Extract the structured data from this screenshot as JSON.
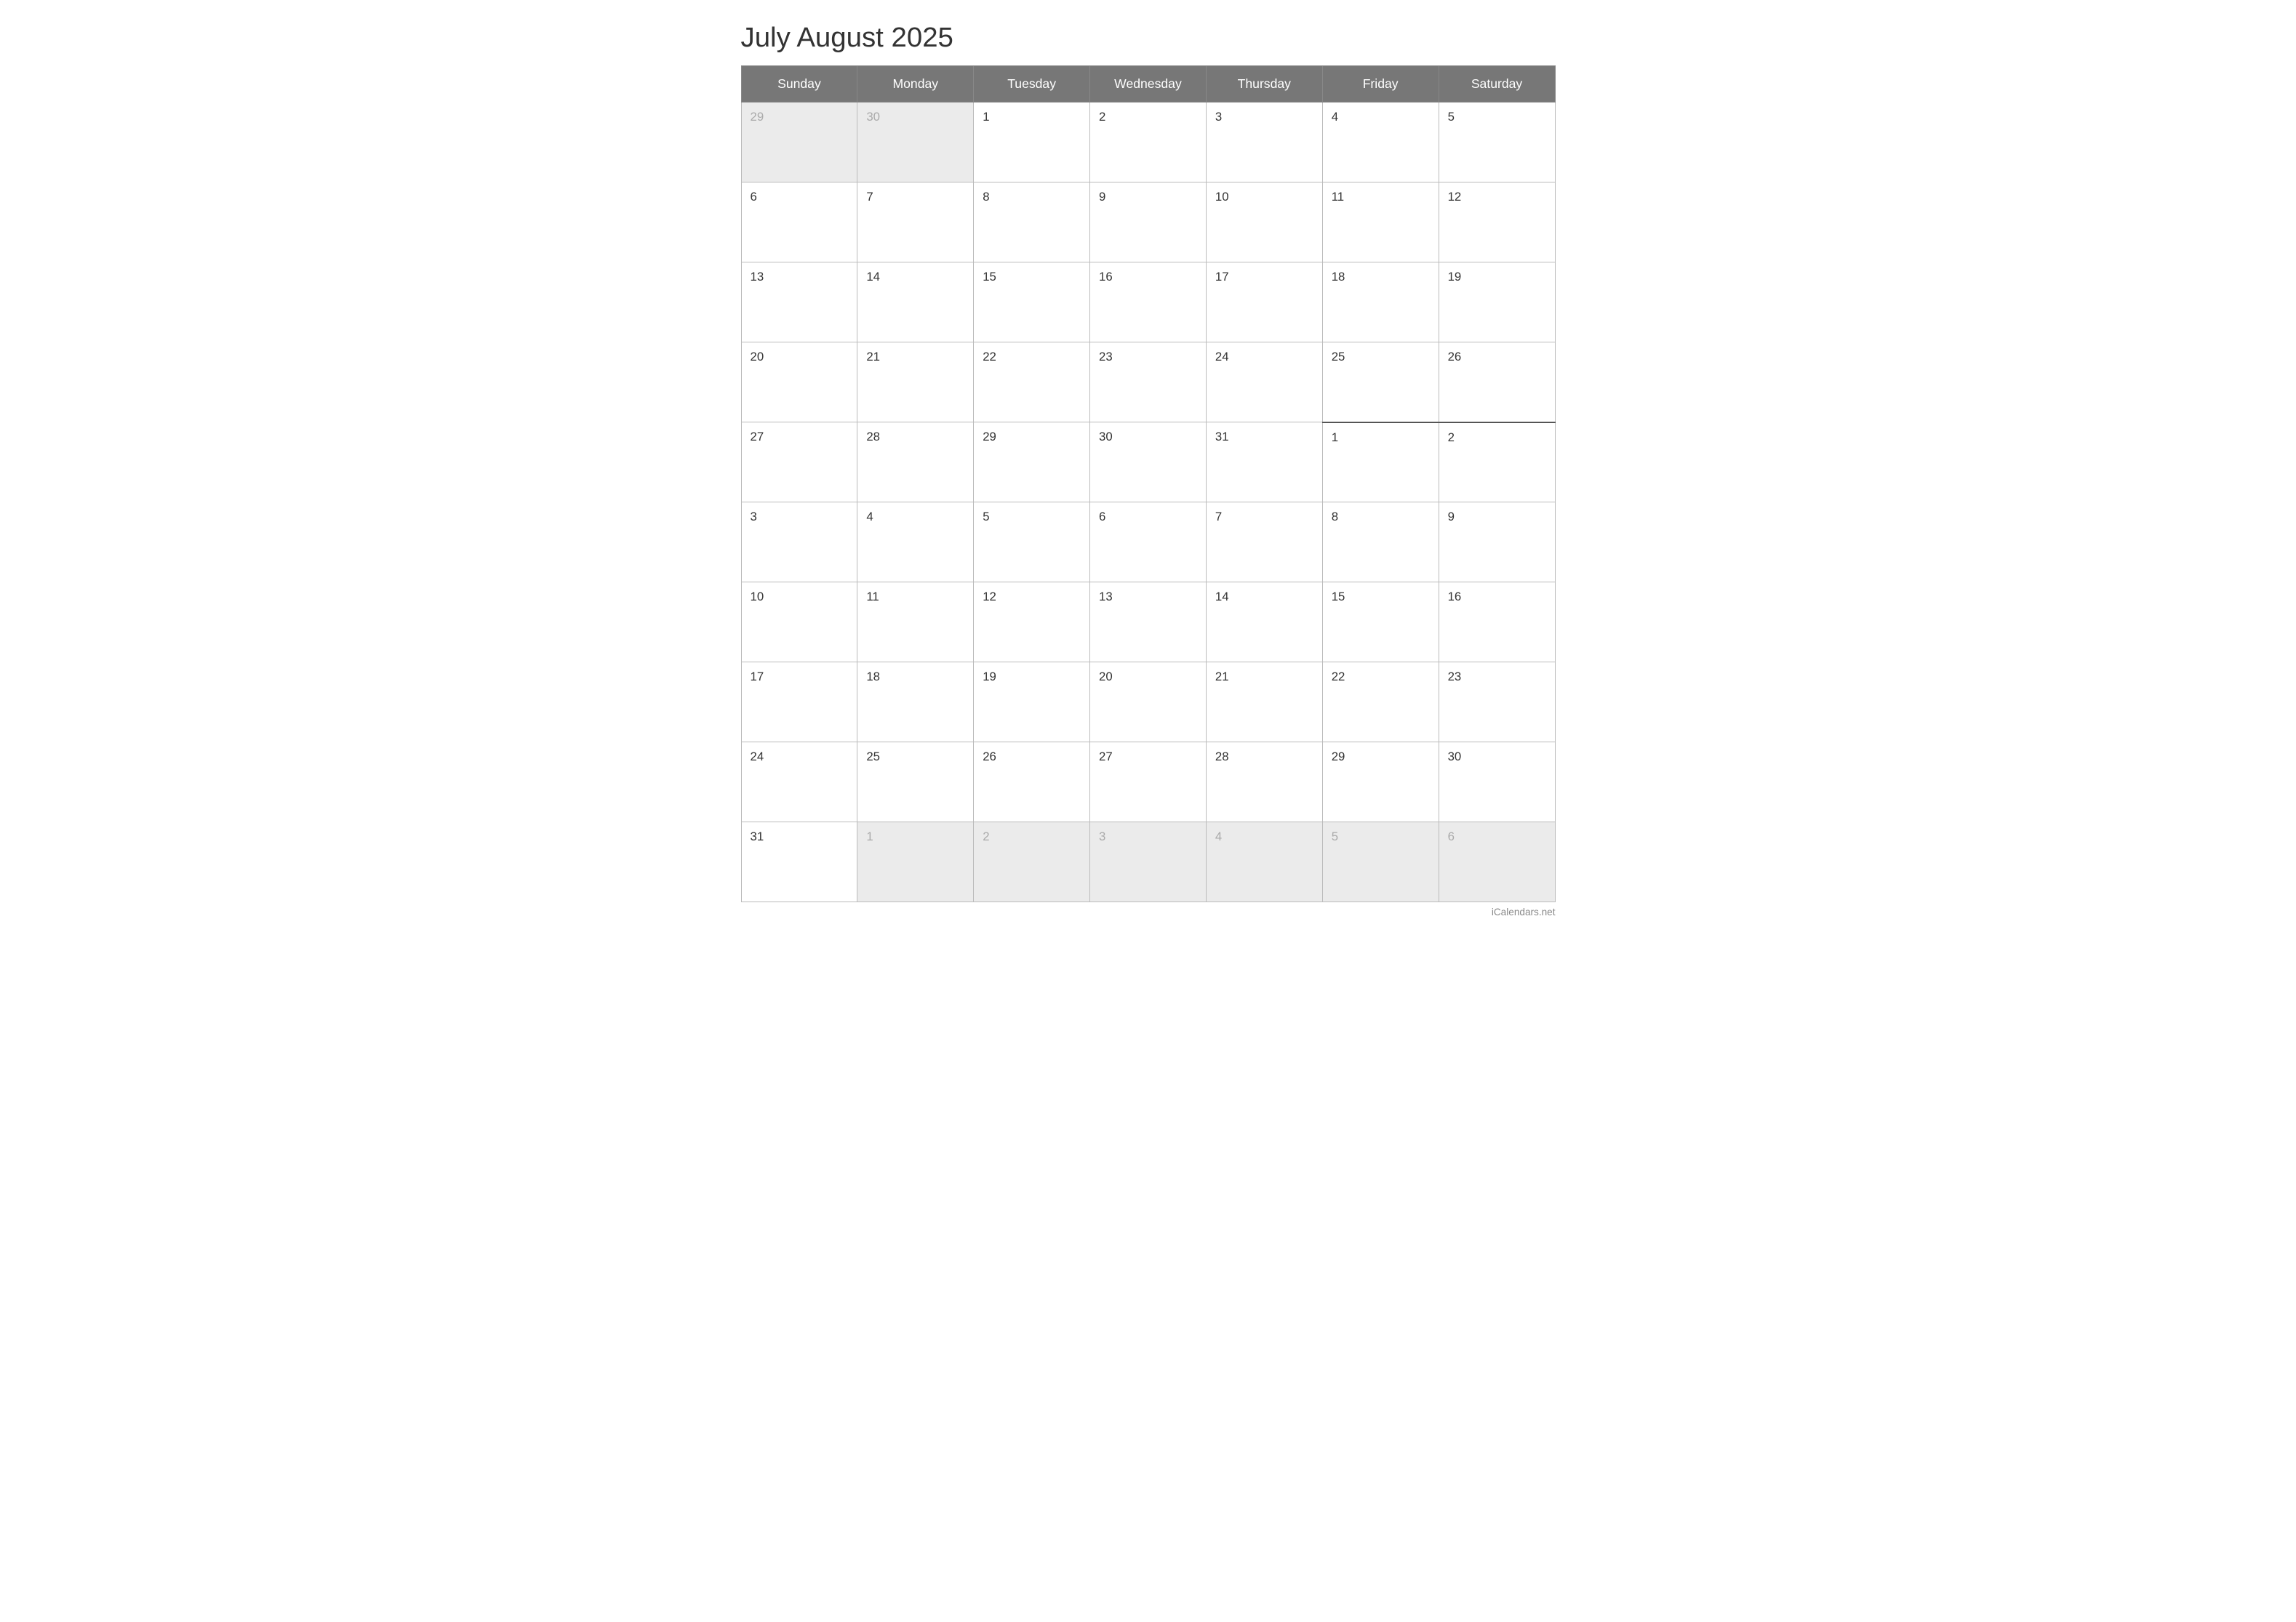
{
  "title": "July August 2025",
  "days_of_week": [
    "Sunday",
    "Monday",
    "Tuesday",
    "Wednesday",
    "Thursday",
    "Friday",
    "Saturday"
  ],
  "weeks": [
    {
      "cells": [
        {
          "day": "29",
          "out": true
        },
        {
          "day": "30",
          "out": true
        },
        {
          "day": "1",
          "out": false
        },
        {
          "day": "2",
          "out": false
        },
        {
          "day": "3",
          "out": false
        },
        {
          "day": "4",
          "out": false
        },
        {
          "day": "5",
          "out": false
        }
      ],
      "divider": false
    },
    {
      "cells": [
        {
          "day": "6",
          "out": false
        },
        {
          "day": "7",
          "out": false
        },
        {
          "day": "8",
          "out": false
        },
        {
          "day": "9",
          "out": false
        },
        {
          "day": "10",
          "out": false
        },
        {
          "day": "11",
          "out": false
        },
        {
          "day": "12",
          "out": false
        }
      ],
      "divider": false
    },
    {
      "cells": [
        {
          "day": "13",
          "out": false
        },
        {
          "day": "14",
          "out": false
        },
        {
          "day": "15",
          "out": false
        },
        {
          "day": "16",
          "out": false
        },
        {
          "day": "17",
          "out": false
        },
        {
          "day": "18",
          "out": false
        },
        {
          "day": "19",
          "out": false
        }
      ],
      "divider": false
    },
    {
      "cells": [
        {
          "day": "20",
          "out": false
        },
        {
          "day": "21",
          "out": false
        },
        {
          "day": "22",
          "out": false
        },
        {
          "day": "23",
          "out": false
        },
        {
          "day": "24",
          "out": false
        },
        {
          "day": "25",
          "out": false
        },
        {
          "day": "26",
          "out": false
        }
      ],
      "divider": false
    },
    {
      "cells": [
        {
          "day": "27",
          "out": false
        },
        {
          "day": "28",
          "out": false
        },
        {
          "day": "29",
          "out": false
        },
        {
          "day": "30",
          "out": false
        },
        {
          "day": "31",
          "out": false
        },
        {
          "day": "1",
          "out": false,
          "new_month": true
        },
        {
          "day": "2",
          "out": false,
          "new_month": true
        }
      ],
      "divider": true
    },
    {
      "cells": [
        {
          "day": "3",
          "out": false
        },
        {
          "day": "4",
          "out": false
        },
        {
          "day": "5",
          "out": false
        },
        {
          "day": "6",
          "out": false
        },
        {
          "day": "7",
          "out": false
        },
        {
          "day": "8",
          "out": false
        },
        {
          "day": "9",
          "out": false
        }
      ],
      "divider": false
    },
    {
      "cells": [
        {
          "day": "10",
          "out": false
        },
        {
          "day": "11",
          "out": false
        },
        {
          "day": "12",
          "out": false
        },
        {
          "day": "13",
          "out": false
        },
        {
          "day": "14",
          "out": false
        },
        {
          "day": "15",
          "out": false
        },
        {
          "day": "16",
          "out": false
        }
      ],
      "divider": false
    },
    {
      "cells": [
        {
          "day": "17",
          "out": false
        },
        {
          "day": "18",
          "out": false
        },
        {
          "day": "19",
          "out": false
        },
        {
          "day": "20",
          "out": false
        },
        {
          "day": "21",
          "out": false
        },
        {
          "day": "22",
          "out": false
        },
        {
          "day": "23",
          "out": false
        }
      ],
      "divider": false
    },
    {
      "cells": [
        {
          "day": "24",
          "out": false
        },
        {
          "day": "25",
          "out": false
        },
        {
          "day": "26",
          "out": false
        },
        {
          "day": "27",
          "out": false
        },
        {
          "day": "28",
          "out": false
        },
        {
          "day": "29",
          "out": false
        },
        {
          "day": "30",
          "out": false
        }
      ],
      "divider": false
    },
    {
      "cells": [
        {
          "day": "31",
          "out": false
        },
        {
          "day": "1",
          "out": true
        },
        {
          "day": "2",
          "out": true
        },
        {
          "day": "3",
          "out": true
        },
        {
          "day": "4",
          "out": true
        },
        {
          "day": "5",
          "out": true
        },
        {
          "day": "6",
          "out": true
        }
      ],
      "divider": false
    }
  ],
  "footer": "iCalendars.net"
}
